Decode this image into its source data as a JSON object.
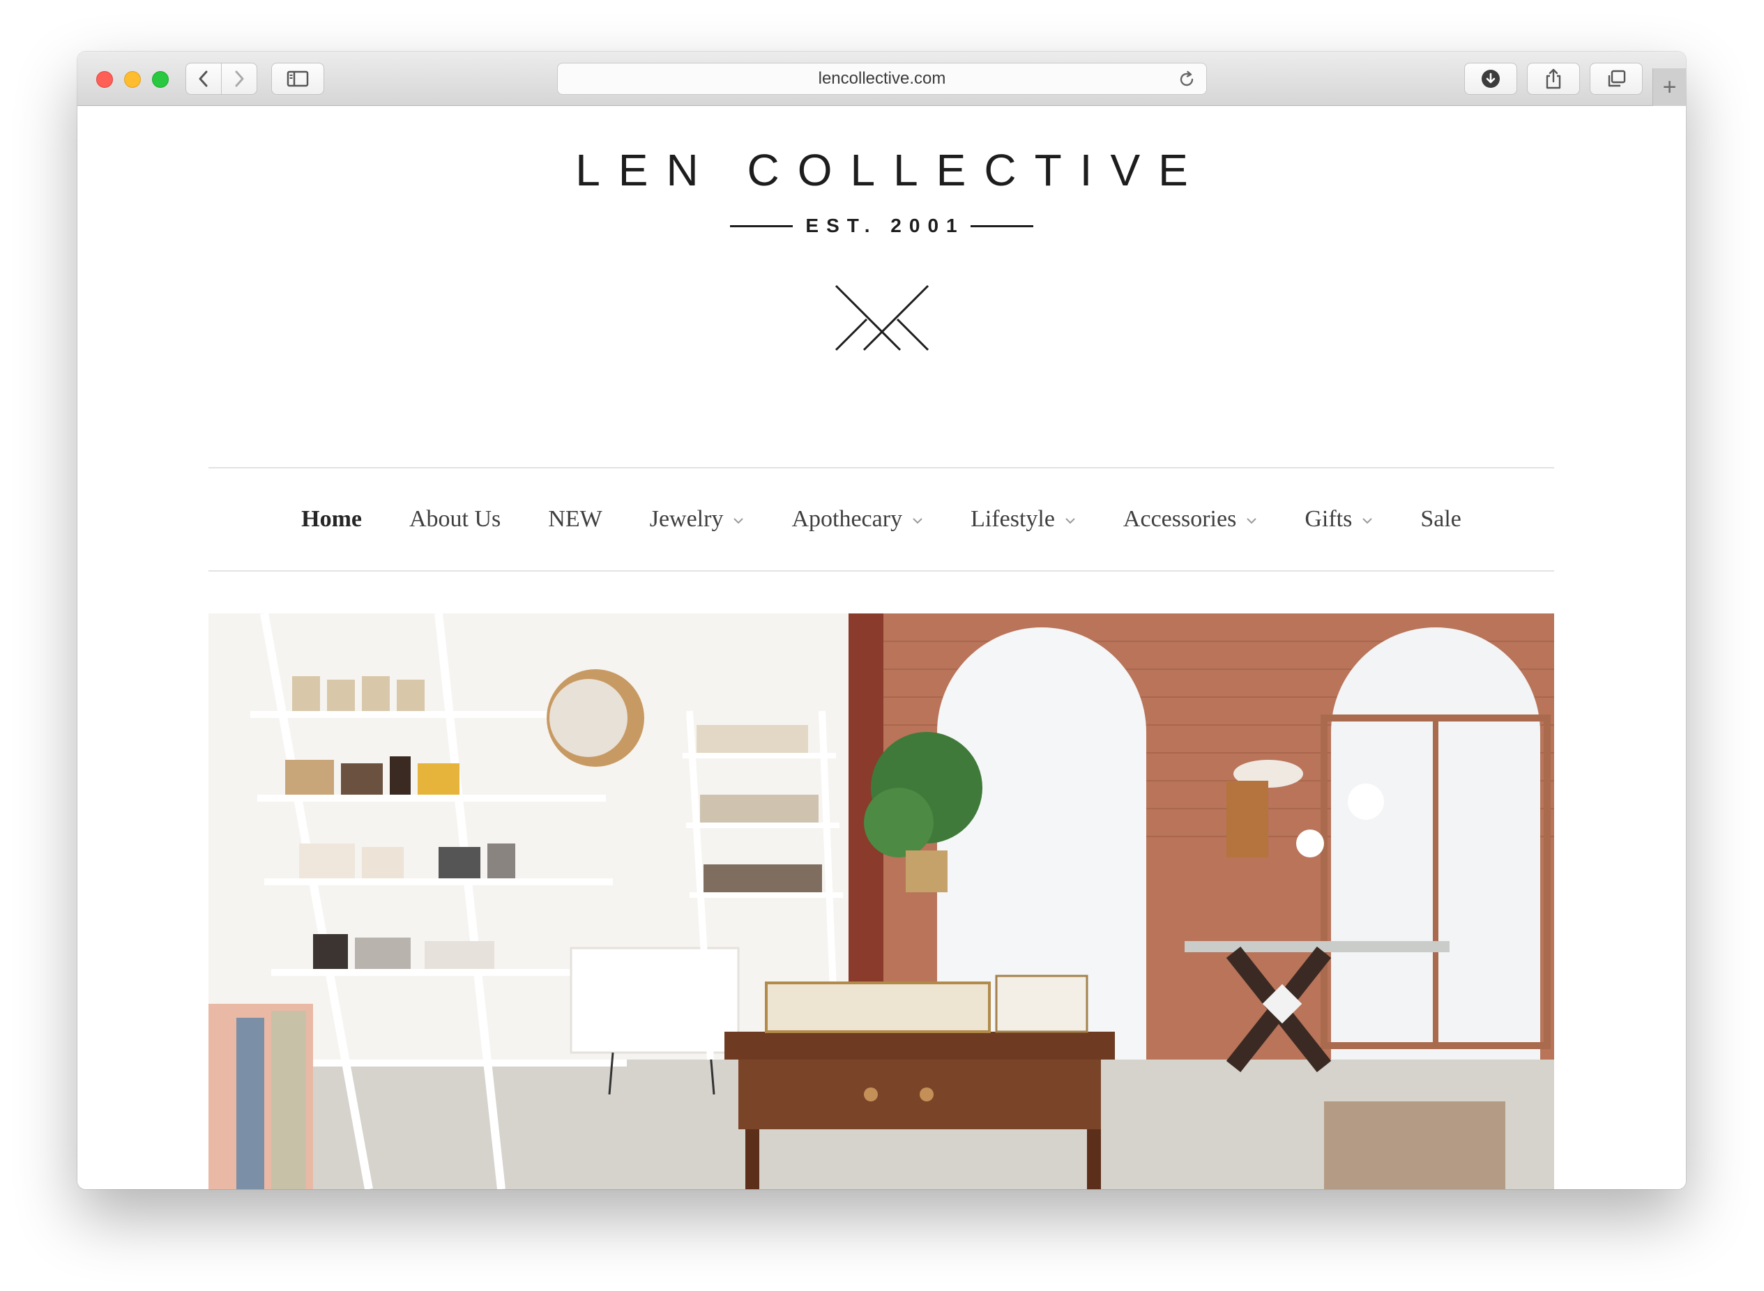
{
  "browser": {
    "url": "lencollective.com",
    "new_tab_label": "+"
  },
  "site": {
    "brand": "LEN COLLECTIVE",
    "established": "EST. 2001"
  },
  "nav": {
    "items": [
      {
        "label": "Home",
        "active": true,
        "has_dropdown": false
      },
      {
        "label": "About Us",
        "active": false,
        "has_dropdown": false
      },
      {
        "label": "NEW",
        "active": false,
        "has_dropdown": false
      },
      {
        "label": "Jewelry",
        "active": false,
        "has_dropdown": true
      },
      {
        "label": "Apothecary",
        "active": false,
        "has_dropdown": true
      },
      {
        "label": "Lifestyle",
        "active": false,
        "has_dropdown": true
      },
      {
        "label": "Accessories",
        "active": false,
        "has_dropdown": true
      },
      {
        "label": "Gifts",
        "active": false,
        "has_dropdown": true
      },
      {
        "label": "Sale",
        "active": false,
        "has_dropdown": false
      }
    ]
  },
  "colors": {
    "text_dark": "#1d1d1d",
    "nav_text": "#3f3f3f",
    "rule": "#e2e2e2"
  },
  "icons": {
    "back": "chevron-left-icon",
    "forward": "chevron-right-icon",
    "sidebar": "sidebar-icon",
    "reload": "reload-icon",
    "download": "download-icon",
    "share": "share-icon",
    "tabs": "tabs-icon",
    "logo": "crossed-lines-logo"
  }
}
